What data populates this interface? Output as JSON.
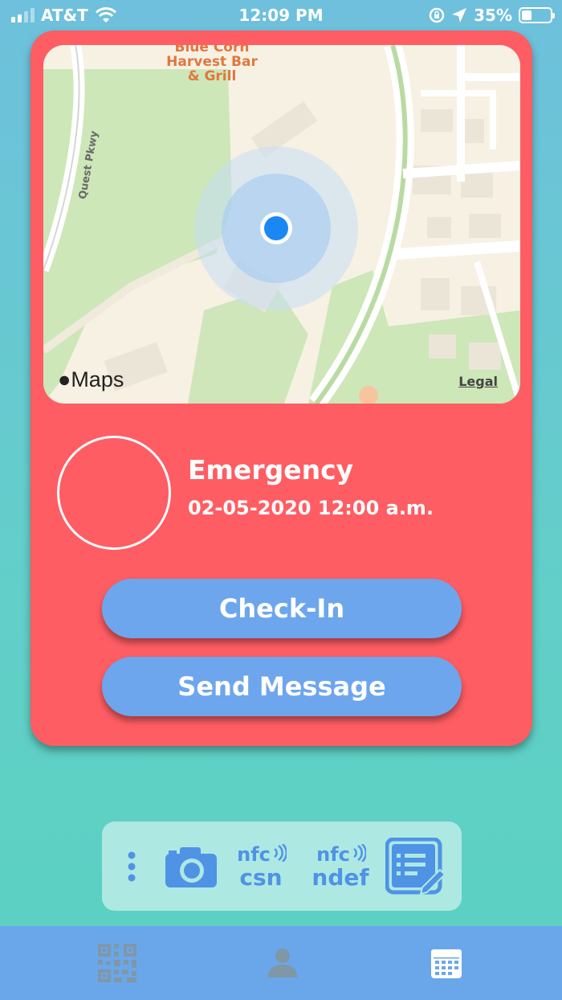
{
  "status_bar": {
    "carrier": "AT&T",
    "time": "12:09 PM",
    "battery": "35%",
    "battery_level": 0.35,
    "icons": [
      "signal-icon",
      "wifi-icon",
      "orientation-lock-icon",
      "location-arrow-icon",
      "battery-icon"
    ]
  },
  "map": {
    "poi_label": "Blue Corn Harvest Bar & Grill",
    "road_label": "Quest Pkwy",
    "brand": "Maps",
    "legal": "Legal"
  },
  "status": {
    "title": "Emergency",
    "datetime": "02-05-2020 12:00 a.m."
  },
  "actions": {
    "checkin_label": "Check-In",
    "send_label": "Send Message"
  },
  "tools": {
    "nfc_csn_top": "nfc",
    "nfc_csn_bottom": "csn",
    "nfc_ndef_top": "nfc",
    "nfc_ndef_bottom": "ndef",
    "icons": [
      "more-vertical-icon",
      "camera-icon",
      "nfc-csn-icon",
      "nfc-ndef-icon",
      "form-edit-icon"
    ]
  },
  "tabbar": {
    "icons": [
      "qr-code-icon",
      "profile-icon",
      "calendar-icon"
    ]
  },
  "colors": {
    "card": "#fe5d63",
    "button": "#6da6ec",
    "tools_bg": "#aee8e3",
    "tool_icon": "#4f93e5",
    "tabbar": "#6aa7ea",
    "location_dot": "#1a87f5"
  }
}
